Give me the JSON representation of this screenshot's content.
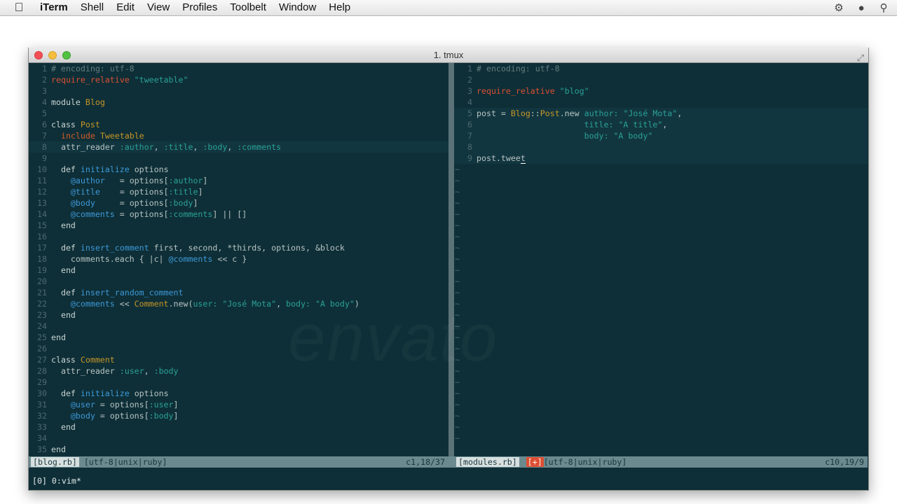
{
  "menubar": {
    "app": "iTerm",
    "items": [
      "Shell",
      "Edit",
      "View",
      "Profiles",
      "Toolbelt",
      "Window",
      "Help"
    ]
  },
  "window": {
    "title": "1. tmux"
  },
  "left_pane": {
    "lines": [
      {
        "n": "1",
        "html": "<span class='c-com'># encoding: utf-8</span>"
      },
      {
        "n": "2",
        "html": "<span class='c-req'>require_relative</span> <span class='c-str'>\"tweetable\"</span>"
      },
      {
        "n": "3",
        "html": ""
      },
      {
        "n": "4",
        "html": "<span class='c-kw'>module</span> <span class='c-const'>Blog</span>"
      },
      {
        "n": "5",
        "html": ""
      },
      {
        "n": "6",
        "html": "<span class='c-kw'>class</span> <span class='c-const'>Post</span>"
      },
      {
        "n": "7",
        "html": "  <span class='c-inc'>include</span> <span class='c-const'>Tweetable</span>"
      },
      {
        "n": "8",
        "cur": true,
        "html": "  <span class='c-txt'>attr_reader</span> <span class='c-sym'>:author</span>, <span class='c-sym'>:title</span>, <span class='c-sym'>:body</span>, <span class='c-sym'>:comments</span>"
      },
      {
        "n": "9",
        "html": ""
      },
      {
        "n": "10",
        "html": "  <span class='c-kw'>def</span> <span class='c-def'>initialize</span> options"
      },
      {
        "n": "11",
        "html": "    <span class='c-ivar'>@author</span>   = options[<span class='c-sym'>:author</span>]"
      },
      {
        "n": "12",
        "html": "    <span class='c-ivar'>@title</span>    = options[<span class='c-sym'>:title</span>]"
      },
      {
        "n": "13",
        "html": "    <span class='c-ivar'>@body</span>     = options[<span class='c-sym'>:body</span>]"
      },
      {
        "n": "14",
        "html": "    <span class='c-ivar'>@comments</span> = options[<span class='c-sym'>:comments</span>] || []"
      },
      {
        "n": "15",
        "html": "  <span class='c-kw'>end</span>"
      },
      {
        "n": "16",
        "html": ""
      },
      {
        "n": "17",
        "html": "  <span class='c-kw'>def</span> <span class='c-def'>insert_comment</span> first, second, *thirds, options, &amp;block"
      },
      {
        "n": "18",
        "html": "    comments.each { |c| <span class='c-ivar'>@comments</span> &lt;&lt; c }"
      },
      {
        "n": "19",
        "html": "  <span class='c-kw'>end</span>"
      },
      {
        "n": "20",
        "html": ""
      },
      {
        "n": "21",
        "html": "  <span class='c-kw'>def</span> <span class='c-def'>insert_random_comment</span>"
      },
      {
        "n": "22",
        "html": "    <span class='c-ivar'>@comments</span> &lt;&lt; <span class='c-const'>Comment</span>.new(<span class='c-sym'>user:</span> <span class='c-str'>\"José Mota\"</span>, <span class='c-sym'>body:</span> <span class='c-str'>\"A body\"</span>)"
      },
      {
        "n": "23",
        "html": "  <span class='c-kw'>end</span>"
      },
      {
        "n": "24",
        "html": ""
      },
      {
        "n": "25",
        "html": "<span class='c-kw'>end</span>"
      },
      {
        "n": "26",
        "html": ""
      },
      {
        "n": "27",
        "html": "<span class='c-kw'>class</span> <span class='c-const'>Comment</span>"
      },
      {
        "n": "28",
        "html": "  <span class='c-txt'>attr_reader</span> <span class='c-sym'>:user</span>, <span class='c-sym'>:body</span>"
      },
      {
        "n": "29",
        "html": ""
      },
      {
        "n": "30",
        "html": "  <span class='c-kw'>def</span> <span class='c-def'>initialize</span> options"
      },
      {
        "n": "31",
        "html": "    <span class='c-ivar'>@user</span> = options[<span class='c-sym'>:user</span>]"
      },
      {
        "n": "32",
        "html": "    <span class='c-ivar'>@body</span> = options[<span class='c-sym'>:body</span>]"
      },
      {
        "n": "33",
        "html": "  <span class='c-kw'>end</span>"
      },
      {
        "n": "34",
        "html": ""
      },
      {
        "n": "35",
        "html": "<span class='c-kw'>end</span>"
      }
    ],
    "status": {
      "file": "[blog.rb]",
      "format": "[utf-8|unix|ruby]",
      "position": "c1,18/37"
    }
  },
  "right_pane": {
    "lines": [
      {
        "n": "1",
        "html": "<span class='c-com'># encoding: utf-8</span>"
      },
      {
        "n": "2",
        "html": ""
      },
      {
        "n": "3",
        "html": "<span class='c-req'>require_relative</span> <span class='c-str'>\"blog\"</span>"
      },
      {
        "n": "4",
        "html": ""
      },
      {
        "n": "5",
        "sel": true,
        "html": "post = <span class='c-const'>Blog</span>::<span class='c-const'>Post</span>.new <span class='c-sym'>author:</span> <span class='c-str'>\"José Mota\"</span>,"
      },
      {
        "n": "6",
        "sel": true,
        "html": "                      <span class='c-sym'>title:</span> <span class='c-str'>\"A title\"</span>,"
      },
      {
        "n": "7",
        "sel": true,
        "html": "                      <span class='c-sym'>body:</span> <span class='c-str'>\"A body\"</span>"
      },
      {
        "n": "8",
        "sel": true,
        "html": ""
      },
      {
        "n": "9",
        "cur": true,
        "html": "post.twee<span class='cursor'>t</span>"
      }
    ],
    "tilde_count": 25,
    "status": {
      "file": "[modules.rb]",
      "modified": "[+]",
      "format": "[utf-8|unix|ruby]",
      "position": "c10,19/9"
    }
  },
  "tmux": {
    "status": "[0] 0:vim*"
  },
  "watermark": "envato"
}
